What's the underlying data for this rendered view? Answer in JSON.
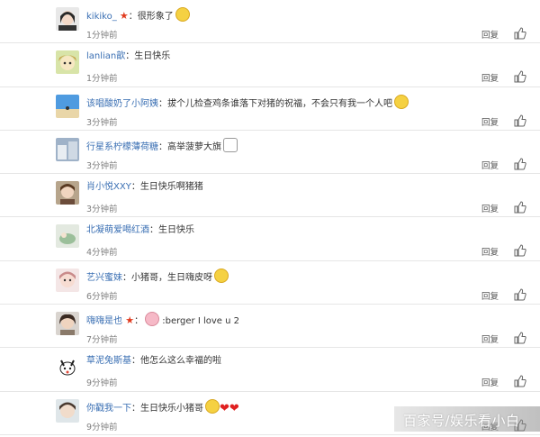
{
  "comments": [
    {
      "user": "kikiko_",
      "badge": "★",
      "text": "很形象了",
      "time": "1分钟前",
      "reply": "回复"
    },
    {
      "user": "lanlian歆",
      "badge": "",
      "text": "生日快乐",
      "time": "1分钟前",
      "reply": "回复"
    },
    {
      "user": "该唱酸奶了小阿姨",
      "badge": "",
      "text": "拔个儿检查鸡条谁落下对猪的祝福，不会只有我一个人吧",
      "time": "3分钟前",
      "reply": "回复"
    },
    {
      "user": "行星系柠檬薄荷糖",
      "badge": "",
      "text": "高举菠萝大旗",
      "time": "3分钟前",
      "reply": "回复"
    },
    {
      "user": "肖小悦XXY",
      "badge": "",
      "text": "生日快乐啊猪猪",
      "time": "3分钟前",
      "reply": "回复"
    },
    {
      "user": "北凝萌爱喝红酒",
      "badge": "",
      "text": "生日快乐",
      "time": "4分钟前",
      "reply": "回复"
    },
    {
      "user": "艺兴蜜妹",
      "badge": "",
      "text": "小猪哥，生日嗨皮呀",
      "time": "6分钟前",
      "reply": "回复"
    },
    {
      "user": "嗨嗨是也",
      "badge": "★",
      "text": ":berger I love u 2",
      "time": "7分钟前",
      "reply": "回复"
    },
    {
      "user": "草泥兔斯基",
      "badge": "",
      "text": "他怎么这么幸福的啦",
      "time": "9分钟前",
      "reply": "回复"
    },
    {
      "user": "你戳我一下",
      "badge": "",
      "text": "生日快乐小猪哥",
      "time": "9分钟前",
      "reply": "回复"
    }
  ],
  "watermark": "百家号/娱乐看小白",
  "colors": {
    "username": "#3a6fb3",
    "badge": "#e03a1e",
    "divider": "#e6e6e6"
  }
}
